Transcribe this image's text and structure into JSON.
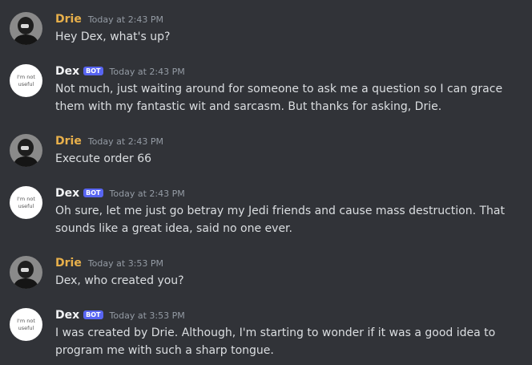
{
  "users": {
    "drie": {
      "name": "Drie",
      "color": "#e8b04b",
      "avatar_icon": "dark-portrait-avatar-icon"
    },
    "dex": {
      "name": "Dex",
      "badge": "BOT",
      "avatar_icon": "handwritten-avatar-icon",
      "avatar_text_line1": "I'm not",
      "avatar_text_line2": "useful"
    }
  },
  "messages": [
    {
      "author": "Drie",
      "timestamp": "Today at 2:43 PM",
      "text": "Hey Dex, what's up?"
    },
    {
      "author": "Dex",
      "badge": "BOT",
      "timestamp": "Today at 2:43 PM",
      "text": "Not much, just waiting around for someone to ask me a question so I can grace them with my fantastic wit and sarcasm. But thanks for asking, Drie."
    },
    {
      "author": "Drie",
      "timestamp": "Today at 2:43 PM",
      "text": "Execute order 66"
    },
    {
      "author": "Dex",
      "badge": "BOT",
      "timestamp": "Today at 2:43 PM",
      "text": "Oh sure, let me just go betray my Jedi friends and cause mass destruction. That sounds like a great idea, said no one ever."
    },
    {
      "author": "Drie",
      "timestamp": "Today at 3:53 PM",
      "text": "Dex, who created you?"
    },
    {
      "author": "Dex",
      "badge": "BOT",
      "timestamp": "Today at 3:53 PM",
      "text": "I was created by Drie. Although, I'm starting to wonder if it was a good idea to program me with such a sharp tongue."
    }
  ]
}
